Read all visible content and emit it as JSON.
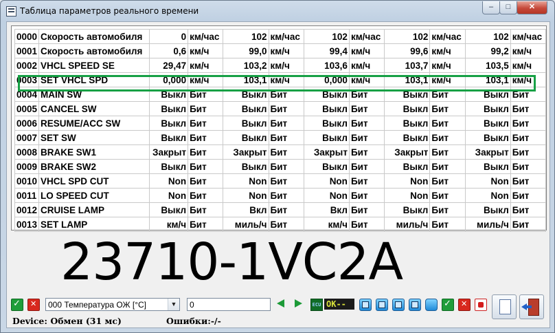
{
  "window": {
    "title": "Таблица параметров реального времени",
    "min_label": "–",
    "max_label": "□",
    "close_label": "✕"
  },
  "grid": {
    "rows": [
      {
        "id": "0000",
        "name": "Скорость автомобиля",
        "cells": [
          [
            "0",
            "км/час"
          ],
          [
            "102",
            "км/час"
          ],
          [
            "102",
            "км/час"
          ],
          [
            "102",
            "км/час"
          ],
          [
            "102",
            "км/час"
          ]
        ]
      },
      {
        "id": "0001",
        "name": "Скорость автомобиля",
        "cells": [
          [
            "0,6",
            "км/ч"
          ],
          [
            "99,0",
            "км/ч"
          ],
          [
            "99,4",
            "км/ч"
          ],
          [
            "99,6",
            "км/ч"
          ],
          [
            "99,2",
            "км/ч"
          ]
        ]
      },
      {
        "id": "0002",
        "name": "VHCL SPEED SE",
        "cells": [
          [
            "29,47",
            "км/ч"
          ],
          [
            "103,2",
            "км/ч"
          ],
          [
            "103,6",
            "км/ч"
          ],
          [
            "103,7",
            "км/ч"
          ],
          [
            "103,5",
            "км/ч"
          ]
        ]
      },
      {
        "id": "0003",
        "name": "SET VHCL SPD",
        "cells": [
          [
            "0,000",
            "км/ч"
          ],
          [
            "103,1",
            "км/ч"
          ],
          [
            "0,000",
            "км/ч"
          ],
          [
            "103,1",
            "км/ч"
          ],
          [
            "103,1",
            "км/ч"
          ]
        ]
      },
      {
        "id": "0004",
        "name": "MAIN SW",
        "cells": [
          [
            "Выкл",
            "Бит"
          ],
          [
            "Выкл",
            "Бит"
          ],
          [
            "Выкл",
            "Бит"
          ],
          [
            "Выкл",
            "Бит"
          ],
          [
            "Выкл",
            "Бит"
          ]
        ]
      },
      {
        "id": "0005",
        "name": "CANCEL SW",
        "cells": [
          [
            "Выкл",
            "Бит"
          ],
          [
            "Выкл",
            "Бит"
          ],
          [
            "Выкл",
            "Бит"
          ],
          [
            "Выкл",
            "Бит"
          ],
          [
            "Выкл",
            "Бит"
          ]
        ]
      },
      {
        "id": "0006",
        "name": "RESUME/ACC SW",
        "cells": [
          [
            "Выкл",
            "Бит"
          ],
          [
            "Выкл",
            "Бит"
          ],
          [
            "Выкл",
            "Бит"
          ],
          [
            "Выкл",
            "Бит"
          ],
          [
            "Выкл",
            "Бит"
          ]
        ]
      },
      {
        "id": "0007",
        "name": "SET SW",
        "cells": [
          [
            "Выкл",
            "Бит"
          ],
          [
            "Выкл",
            "Бит"
          ],
          [
            "Выкл",
            "Бит"
          ],
          [
            "Выкл",
            "Бит"
          ],
          [
            "Выкл",
            "Бит"
          ]
        ]
      },
      {
        "id": "0008",
        "name": "BRAKE SW1",
        "cells": [
          [
            "Закрыт",
            "Бит"
          ],
          [
            "Закрыт",
            "Бит"
          ],
          [
            "Закрыт",
            "Бит"
          ],
          [
            "Закрыт",
            "Бит"
          ],
          [
            "Закрыт",
            "Бит"
          ]
        ]
      },
      {
        "id": "0009",
        "name": "BRAKE SW2",
        "cells": [
          [
            "Выкл",
            "Бит"
          ],
          [
            "Выкл",
            "Бит"
          ],
          [
            "Выкл",
            "Бит"
          ],
          [
            "Выкл",
            "Бит"
          ],
          [
            "Выкл",
            "Бит"
          ]
        ]
      },
      {
        "id": "0010",
        "name": "VHCL SPD CUT",
        "cells": [
          [
            "Non",
            "Бит"
          ],
          [
            "Non",
            "Бит"
          ],
          [
            "Non",
            "Бит"
          ],
          [
            "Non",
            "Бит"
          ],
          [
            "Non",
            "Бит"
          ]
        ]
      },
      {
        "id": "0011",
        "name": "LO SPEED CUT",
        "cells": [
          [
            "Non",
            "Бит"
          ],
          [
            "Non",
            "Бит"
          ],
          [
            "Non",
            "Бит"
          ],
          [
            "Non",
            "Бит"
          ],
          [
            "Non",
            "Бит"
          ]
        ]
      },
      {
        "id": "0012",
        "name": "CRUISE LAMP",
        "cells": [
          [
            "Выкл",
            "Бит"
          ],
          [
            "Вкл",
            "Бит"
          ],
          [
            "Вкл",
            "Бит"
          ],
          [
            "Выкл",
            "Бит"
          ],
          [
            "Выкл",
            "Бит"
          ]
        ]
      },
      {
        "id": "0013",
        "name": "SET LAMP",
        "cells": [
          [
            "км/ч",
            "Бит"
          ],
          [
            "миль/ч",
            "Бит"
          ],
          [
            "км/ч",
            "Бит"
          ],
          [
            "миль/ч",
            "Бит"
          ],
          [
            "миль/ч",
            "Бит"
          ]
        ]
      }
    ],
    "highlight_color": "#17a045"
  },
  "overlay": {
    "part_number": "23710-1VC2A"
  },
  "toolbar": {
    "parameter_select": "000 Температура ОЖ [°C]",
    "value_input": "0",
    "ecu_badge": "ECU",
    "ok_indicator": "OK--"
  },
  "status": {
    "device": "Device: Обмен (31 мс)",
    "errors": "Ошибки:-/-"
  }
}
